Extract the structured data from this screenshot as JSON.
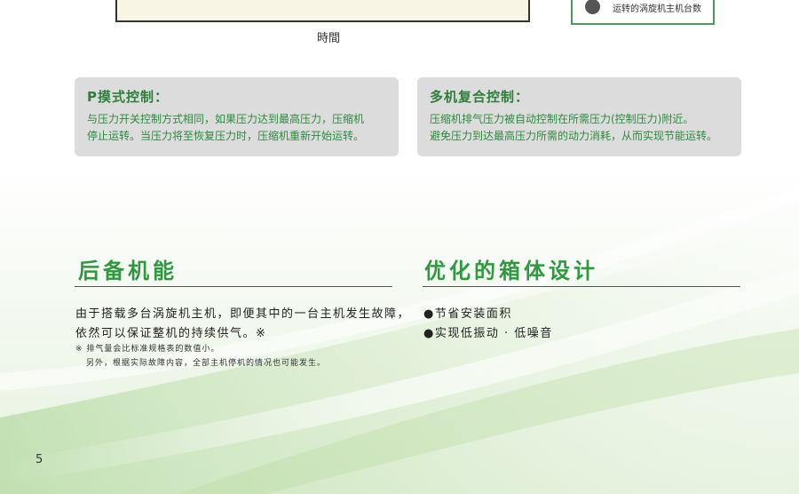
{
  "chart": {
    "x_axis_label": "時間",
    "legend_label": "运转的涡旋机主机台数"
  },
  "cards": [
    {
      "title": "P摸式控制：",
      "lines": [
        "与压力开关控制方式相同，如果压力达到最高压力，压缩机",
        "停止运转。当压力将至恢复压力时，压缩机重新开始运转。"
      ]
    },
    {
      "title": "多机复合控制：",
      "lines": [
        "压缩机排气压力被自动控制在所需压力(控制压力)附近。",
        "避免压力到达最高压力所需的动力消耗，从而实现节能运转。"
      ]
    }
  ],
  "backup": {
    "title": "后备机能",
    "lines": [
      "由于搭载多台涡旋机主机，即便其中的一台主机发生故障，",
      "依然可以保证整机的持续供气。※"
    ],
    "notes": [
      "※ 排气量会比标准规格表的数值小。",
      "另外，根据实际故障内容，全部主机停机的情况也可能发生。"
    ]
  },
  "design": {
    "title": "优化的箱体设计",
    "bullets": [
      "●节省安装面积",
      "●实现低振动 · 低噪音"
    ]
  },
  "page_number": "5",
  "colors": {
    "accent_green": "#2d9a3e",
    "card_gray": "#dcdcdc"
  }
}
